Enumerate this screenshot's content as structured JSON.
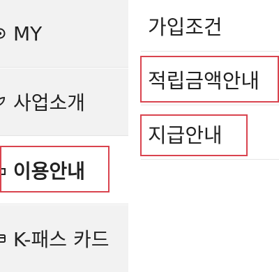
{
  "left_nav": {
    "items": [
      {
        "label": "MY",
        "icon": "settings-icon"
      },
      {
        "label": "사업소개",
        "icon": "leaf-icon"
      },
      {
        "label": "이용안내",
        "icon": "folder-icon",
        "active": true
      },
      {
        "label": "K-패스 카드",
        "icon": "card-icon"
      }
    ]
  },
  "sub_menu": {
    "items": [
      {
        "label": "가입조건"
      },
      {
        "label": "적립금액안내"
      },
      {
        "label": "지급안내"
      }
    ]
  },
  "colors": {
    "highlight": "#d9434e",
    "nav_background": "#f2f2f2",
    "active_background": "#ffffff",
    "text": "#222222",
    "divider": "#e6e6e6"
  }
}
